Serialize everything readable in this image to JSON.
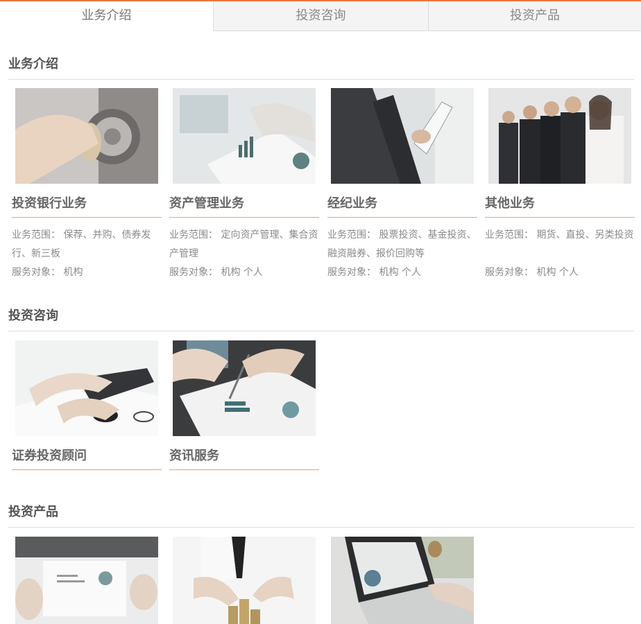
{
  "tabs": [
    {
      "label": "业务介绍"
    },
    {
      "label": "投资咨询"
    },
    {
      "label": "投资产品"
    }
  ],
  "sections": {
    "business": {
      "title": "业务介绍",
      "cards": [
        {
          "title": "投资银行业务",
          "scope": "业务范围： 保荐、并购、债券发行、新三板",
          "target": "服务对象： 机构"
        },
        {
          "title": "资产管理业务",
          "scope": "业务范围： 定向资产管理、集合资产管理",
          "target": "服务对象： 机构 个人"
        },
        {
          "title": "经纪业务",
          "scope": "业务范围： 股票投资、基金投资、融资融券、报价回购等",
          "target": "服务对象： 机构 个人"
        },
        {
          "title": "其他业务",
          "scope": "业务范围： 期货、直投、另类投资",
          "target": "服务对象： 机构 个人"
        }
      ]
    },
    "consulting": {
      "title": "投资咨询",
      "cards": [
        {
          "title": "证券投资顾问"
        },
        {
          "title": "资讯服务"
        }
      ]
    },
    "products": {
      "title": "投资产品"
    }
  },
  "colors": {
    "accent": "#e8793c",
    "card_rule": "#e8a36d"
  }
}
